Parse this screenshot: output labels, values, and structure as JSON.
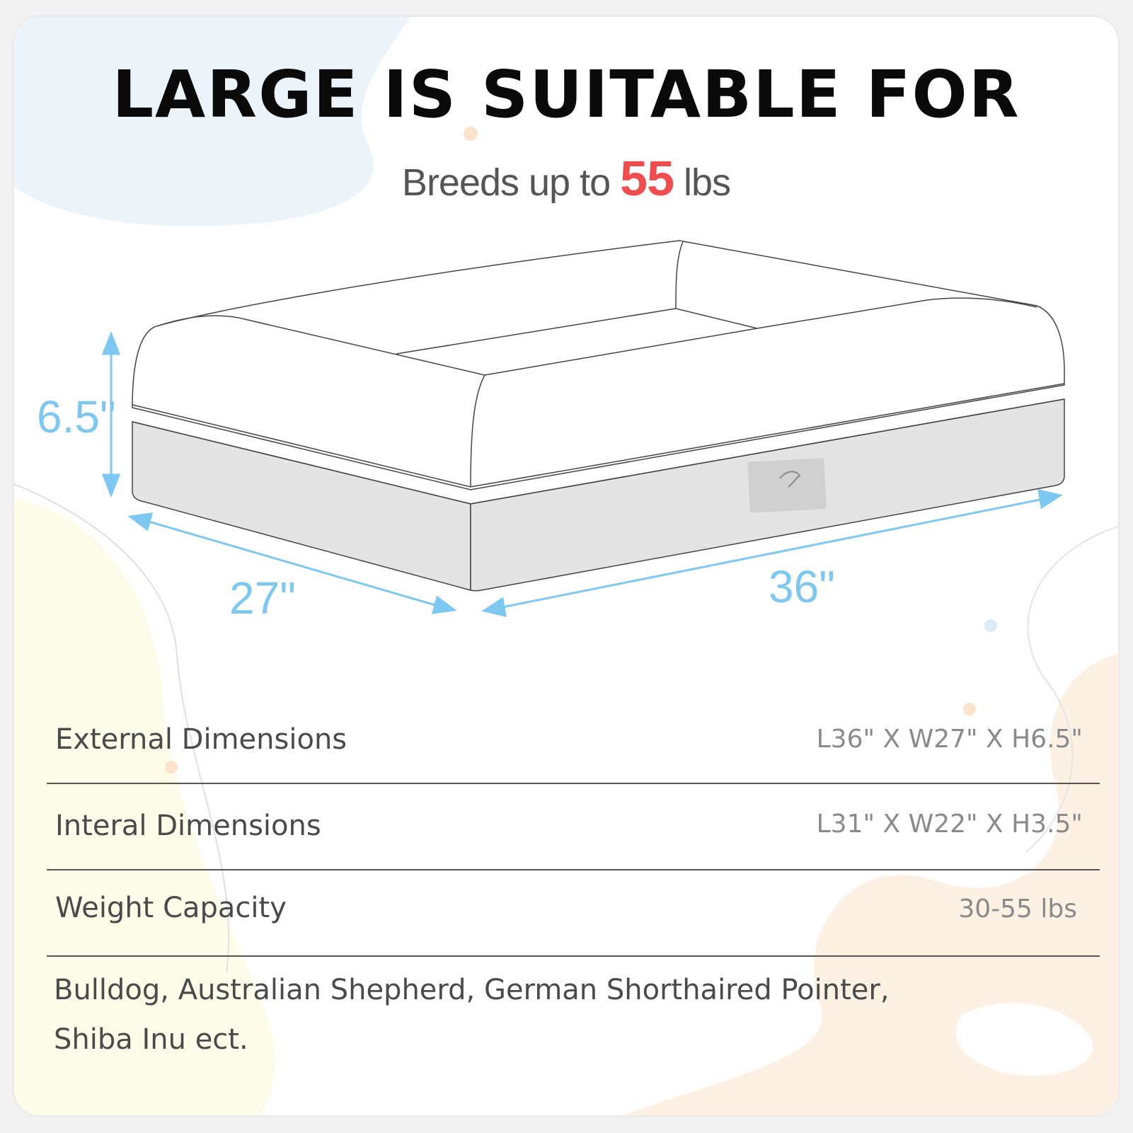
{
  "heading": {
    "title": "LARGE IS SUITABLE FOR",
    "subtitle_prefix": "Breeds up to ",
    "subtitle_number": "55",
    "subtitle_suffix": " lbs"
  },
  "dimensions": {
    "height": "6.5\"",
    "width": "27\"",
    "length": "36\""
  },
  "specs": [
    {
      "label": "External Dimensions",
      "value": "L36\" X W27\" X H6.5\""
    },
    {
      "label": "Interal Dimensions",
      "value": "L31\" X W22\" X H3.5\""
    },
    {
      "label": "Weight Capacity",
      "value": "30-55 lbs"
    }
  ],
  "breeds": {
    "line1": "Bulldog, Australian Shepherd, German Shorthaired Pointer,",
    "line2": "Shiba Inu ect."
  },
  "colors": {
    "accent_red": "#f04e4e",
    "dimension_blue": "#7dc8f0",
    "bed_base": "#e4e4e4"
  }
}
